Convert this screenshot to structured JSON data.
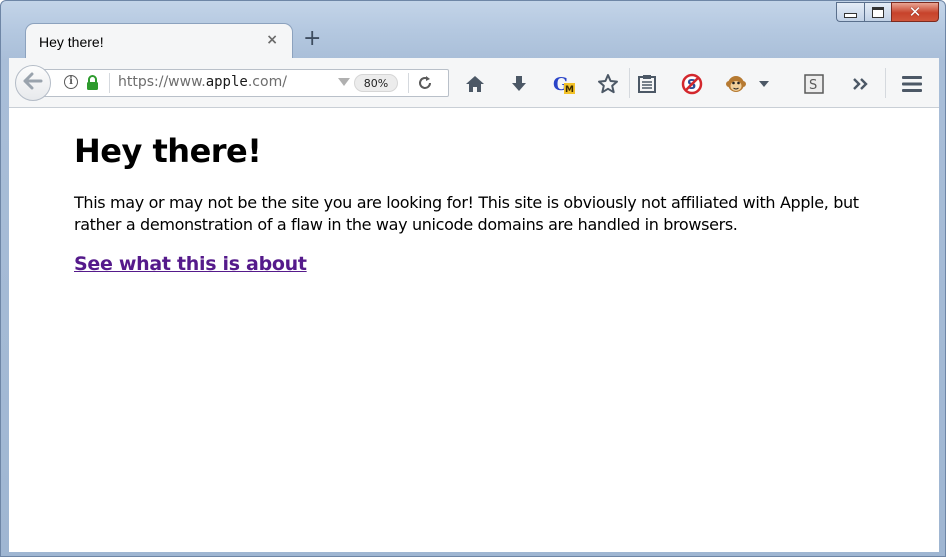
{
  "window": {
    "controls": {
      "minimize": "minimize-icon",
      "maximize": "maximize-icon",
      "close": "close-icon"
    }
  },
  "tab": {
    "title": "Hey there!",
    "close_glyph": "×",
    "new_tab_glyph": "+"
  },
  "urlbar": {
    "scheme": "https://www.",
    "host": "apple",
    "suffix": ".com/",
    "zoom": "80%"
  },
  "toolbar": {
    "icons": [
      "home-icon",
      "download-icon",
      "translate-addon-icon",
      "bookmark-star-icon",
      "reader-list-icon",
      "stylish-addon-icon",
      "greasemonkey-icon",
      "menu-dropdown-icon",
      "screenshot-addon-icon",
      "overflow-icon",
      "hamburger-menu-icon"
    ]
  },
  "page": {
    "heading": "Hey there!",
    "body": "This may or may not be the site you are looking for! This site is obviously not affiliated with Apple, but rather a demonstration of a flaw in the way unicode domains are handled in browsers.",
    "link": "See what this is about"
  },
  "colors": {
    "link_visited": "#551a8b",
    "lock_green": "#2e9b2e",
    "close_red": "#c7432b"
  }
}
